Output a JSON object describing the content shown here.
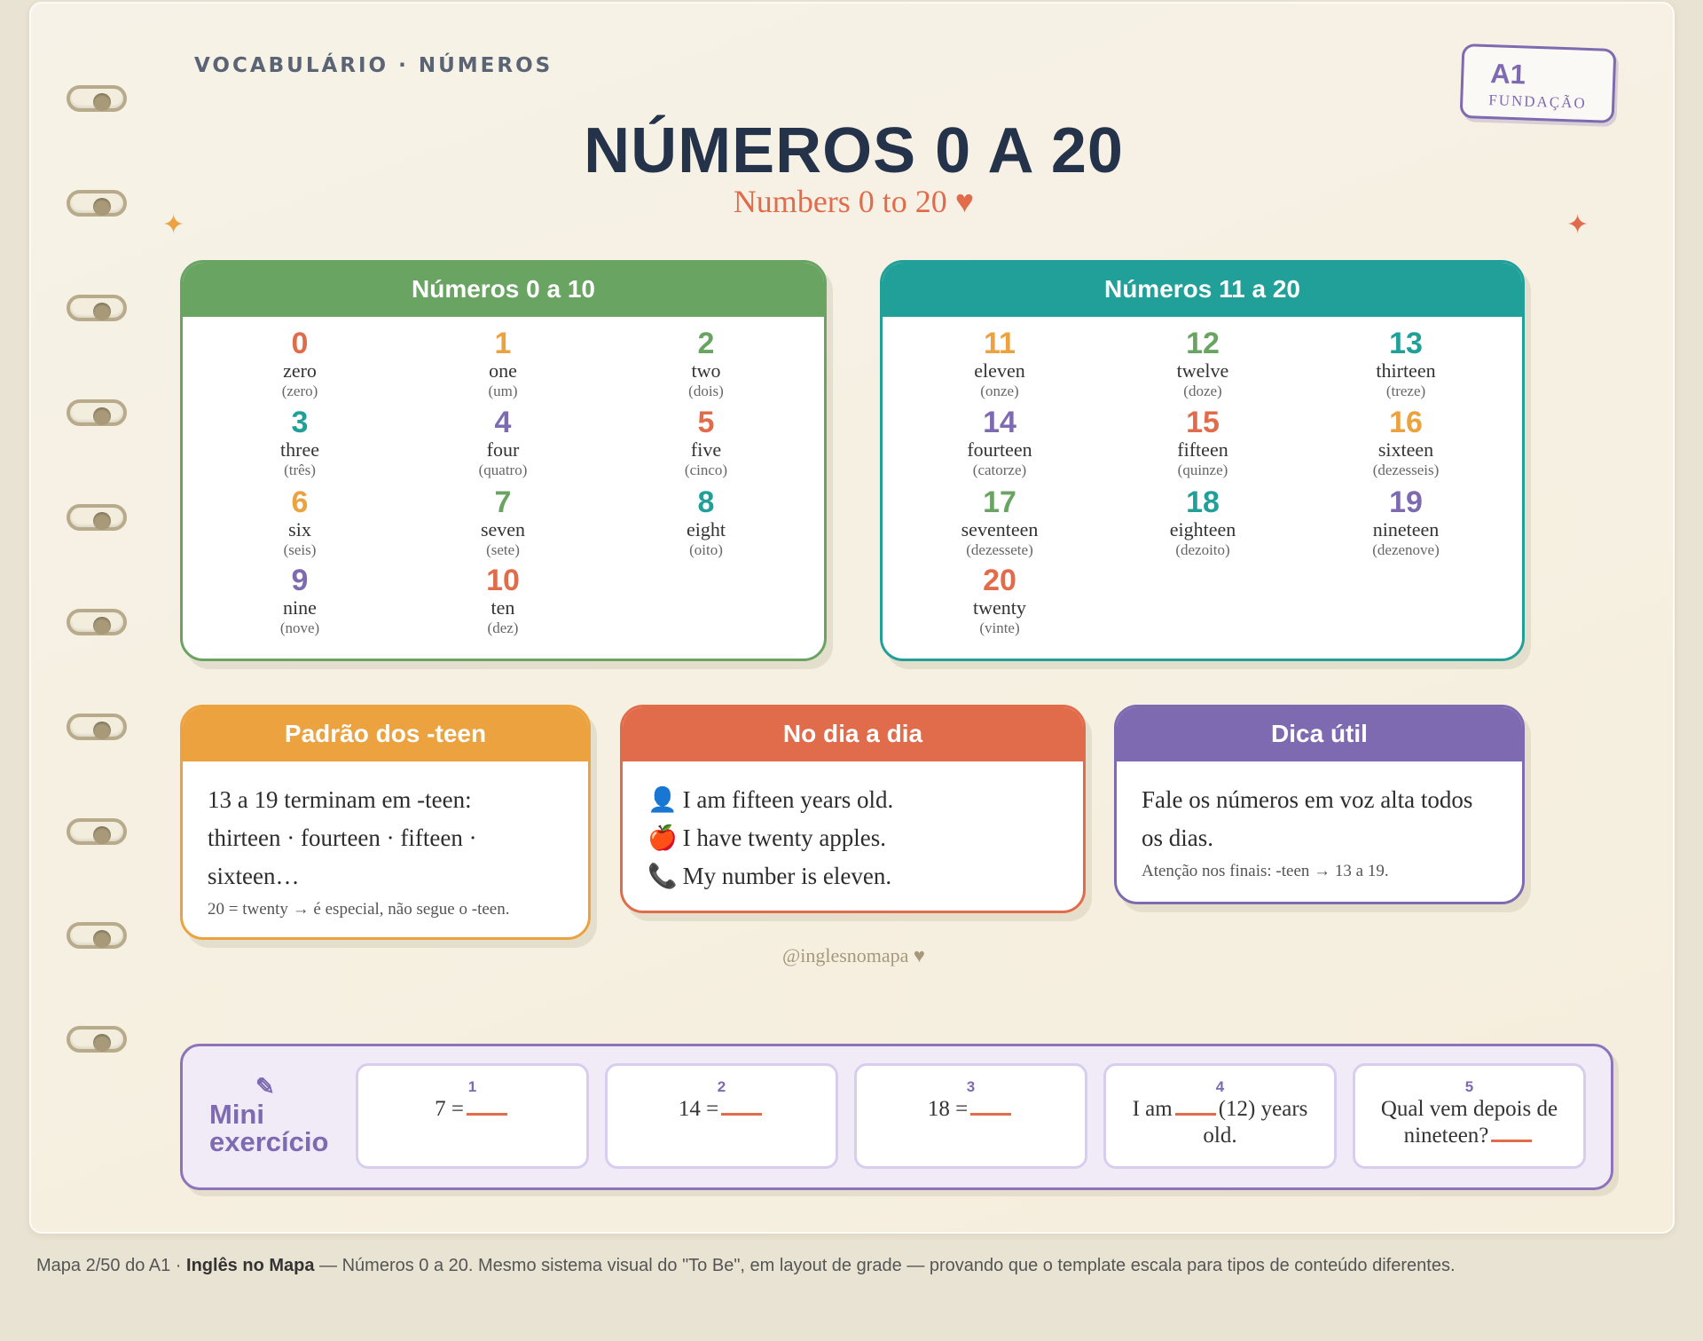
{
  "header": {
    "kicker": "VOCABULÁRIO · NÚMEROS",
    "badge_level": "A1",
    "badge_sub": "FUNDAÇÃO",
    "title": "NÚMEROS 0 A 20",
    "subtitle": "Numbers 0 to 20 ♥",
    "sparkle": "✦"
  },
  "cards": {
    "first": {
      "title": "Números 0 a 10",
      "items": [
        {
          "n": "0",
          "en": "zero",
          "pt": "(zero)",
          "color": "#e06c4c"
        },
        {
          "n": "1",
          "en": "one",
          "pt": "(um)",
          "color": "#eba23f"
        },
        {
          "n": "2",
          "en": "two",
          "pt": "(dois)",
          "color": "#6aa463"
        },
        {
          "n": "3",
          "en": "three",
          "pt": "(três)",
          "color": "#20a099"
        },
        {
          "n": "4",
          "en": "four",
          "pt": "(quatro)",
          "color": "#7e6ab0"
        },
        {
          "n": "5",
          "en": "five",
          "pt": "(cinco)",
          "color": "#e06c4c"
        },
        {
          "n": "6",
          "en": "six",
          "pt": "(seis)",
          "color": "#eba23f"
        },
        {
          "n": "7",
          "en": "seven",
          "pt": "(sete)",
          "color": "#6aa463"
        },
        {
          "n": "8",
          "en": "eight",
          "pt": "(oito)",
          "color": "#20a099"
        },
        {
          "n": "9",
          "en": "nine",
          "pt": "(nove)",
          "color": "#7e6ab0"
        },
        {
          "n": "10",
          "en": "ten",
          "pt": "(dez)",
          "color": "#e06c4c"
        }
      ]
    },
    "second": {
      "title": "Números 11 a 20",
      "items": [
        {
          "n": "11",
          "en": "eleven",
          "pt": "(onze)",
          "color": "#eba23f"
        },
        {
          "n": "12",
          "en": "twelve",
          "pt": "(doze)",
          "color": "#6aa463"
        },
        {
          "n": "13",
          "en": "thirteen",
          "pt": "(treze)",
          "color": "#20a099"
        },
        {
          "n": "14",
          "en": "fourteen",
          "pt": "(catorze)",
          "color": "#7e6ab0"
        },
        {
          "n": "15",
          "en": "fifteen",
          "pt": "(quinze)",
          "color": "#e06c4c"
        },
        {
          "n": "16",
          "en": "sixteen",
          "pt": "(dezesseis)",
          "color": "#eba23f"
        },
        {
          "n": "17",
          "en": "seventeen",
          "pt": "(dezessete)",
          "color": "#6aa463"
        },
        {
          "n": "18",
          "en": "eighteen",
          "pt": "(dezoito)",
          "color": "#20a099"
        },
        {
          "n": "19",
          "en": "nineteen",
          "pt": "(dezenove)",
          "color": "#7e6ab0"
        },
        {
          "n": "20",
          "en": "twenty",
          "pt": "(vinte)",
          "color": "#e06c4c"
        }
      ]
    }
  },
  "teen": {
    "title": "Padrão dos -teen",
    "line1": "13 a 19 terminam em -teen:",
    "line2": "thirteen · fourteen · fifteen ·",
    "line3": "sixteen…",
    "note": "20 = twenty → é especial, não segue o -teen."
  },
  "daily": {
    "title": "No dia a dia",
    "lines": [
      {
        "icon": "👤",
        "text": "I am fifteen years old."
      },
      {
        "icon": "🍎",
        "text": "I have twenty apples."
      },
      {
        "icon": "📞",
        "text": "My number is eleven."
      }
    ]
  },
  "tip": {
    "title": "Dica útil",
    "line1": "Fale os números em voz alta todos",
    "line2": "os dias.",
    "note": "Atenção nos finais: -teen → 13 a 19."
  },
  "handle": "@inglesnomapa ♥",
  "exercise": {
    "pen": "✎",
    "label1": "Mini",
    "label2": "exercício",
    "items": [
      {
        "n": "1",
        "pre": "7 =",
        "post": ""
      },
      {
        "n": "2",
        "pre": "14 =",
        "post": ""
      },
      {
        "n": "3",
        "pre": "18 =",
        "post": ""
      },
      {
        "n": "4",
        "pre": "I am",
        "post": "(12) years old."
      },
      {
        "n": "5",
        "pre": "Qual vem depois de nineteen?",
        "post": ""
      }
    ]
  },
  "caption": {
    "prefix": "Mapa 2/50 do A1 · ",
    "brand": "Inglês no Mapa",
    "rest": " — Números 0 a 20. Mesmo sistema visual do \"To Be\", em layout de grade — provando que o template escala para tipos de conteúdo diferentes."
  },
  "colors": {
    "green": "#6aa463",
    "teal": "#20a099",
    "orange": "#eba23f",
    "red": "#e06c4c",
    "purple": "#7e6ab0",
    "navy": "#25334a"
  }
}
